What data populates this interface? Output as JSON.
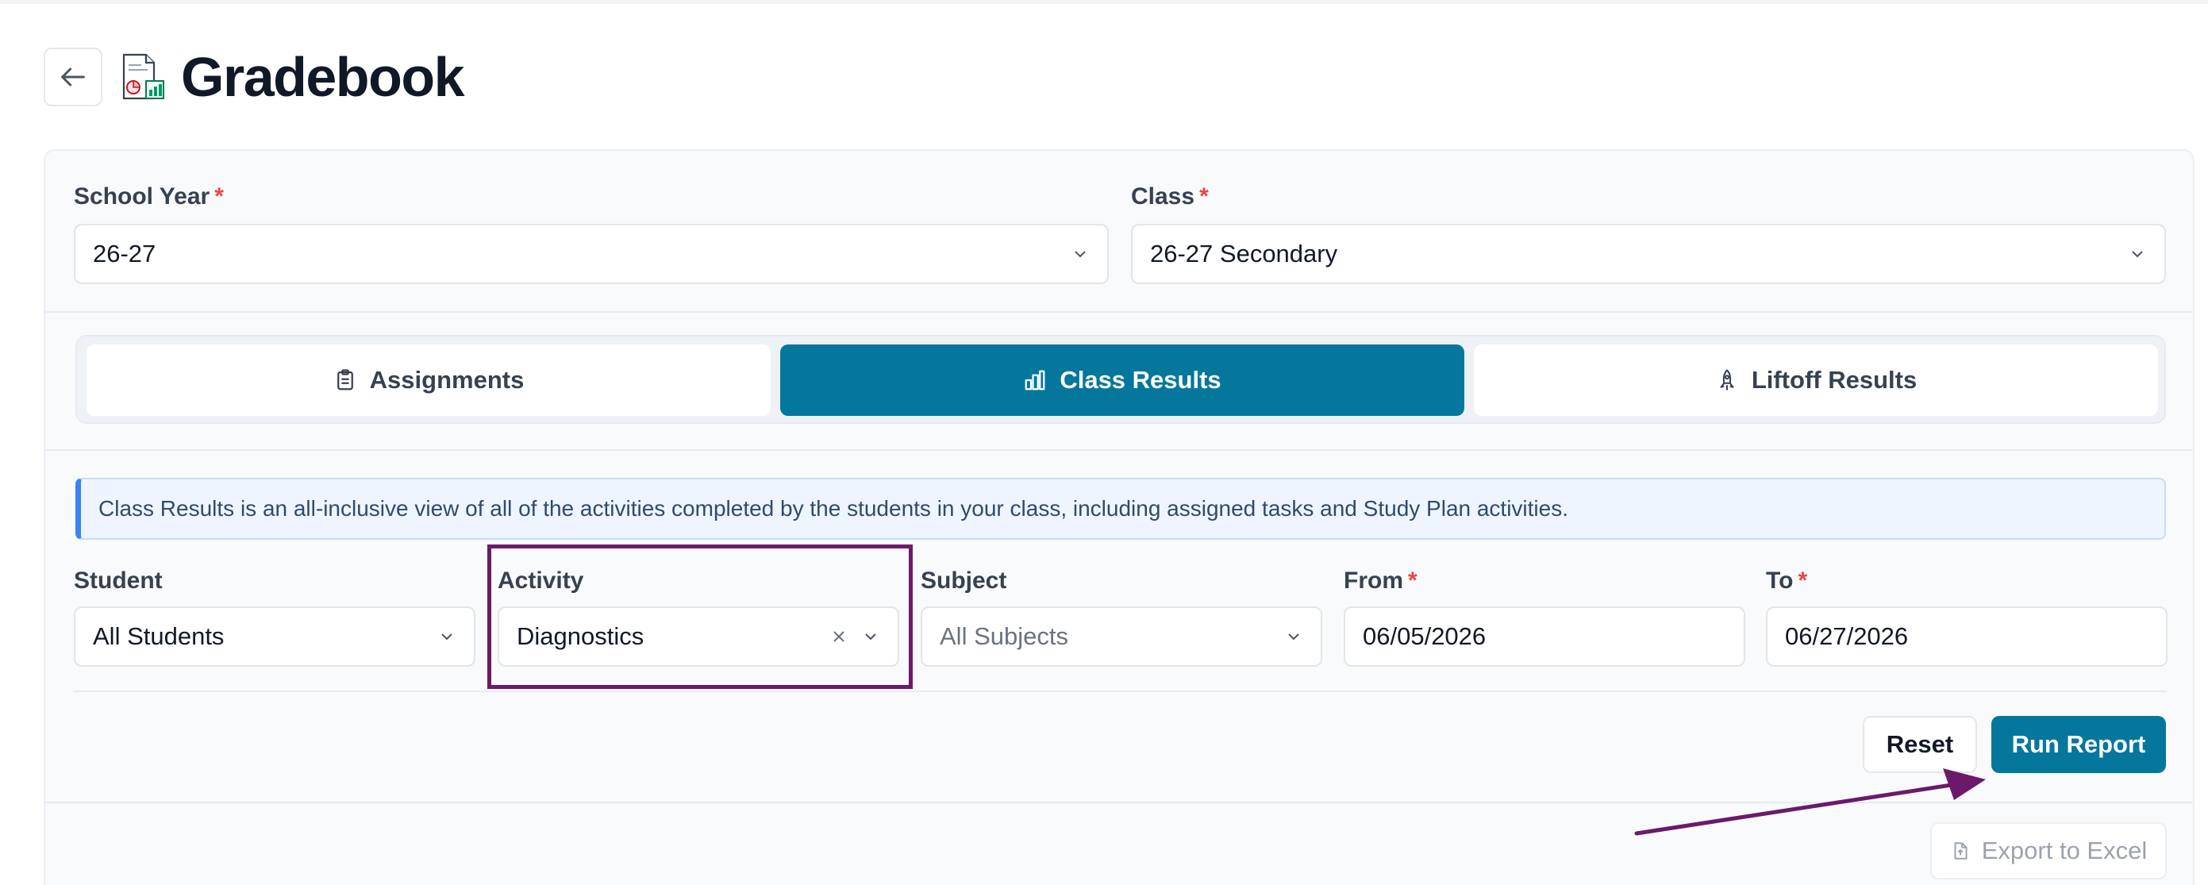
{
  "header": {
    "title": "Gradebook"
  },
  "filters_top": {
    "school_year": {
      "label": "School Year",
      "value": "26-27"
    },
    "class": {
      "label": "Class",
      "value": "26-27 Secondary"
    },
    "required_mark": "*"
  },
  "tabs": [
    {
      "label": "Assignments",
      "icon": "clipboard-icon",
      "active": false
    },
    {
      "label": "Class Results",
      "icon": "bar-chart-icon",
      "active": true
    },
    {
      "label": "Liftoff Results",
      "icon": "rocket-icon",
      "active": false
    }
  ],
  "info_text": "Class Results is an all-inclusive view of all of the activities completed by the students in your class, including assigned tasks and Study Plan activities.",
  "filters": {
    "student": {
      "label": "Student",
      "value": "All Students"
    },
    "activity": {
      "label": "Activity",
      "value": "Diagnostics"
    },
    "subject": {
      "label": "Subject",
      "placeholder": "All Subjects"
    },
    "from": {
      "label": "From",
      "value": "06/05/2026"
    },
    "to": {
      "label": "To",
      "value": "06/27/2026"
    }
  },
  "actions": {
    "reset": "Reset",
    "run_report": "Run Report",
    "export": "Export to Excel"
  },
  "colors": {
    "primary": "#06779c",
    "required": "#ef4444",
    "annotation": "#6b1a6b",
    "info_border": "#3b82f6"
  }
}
